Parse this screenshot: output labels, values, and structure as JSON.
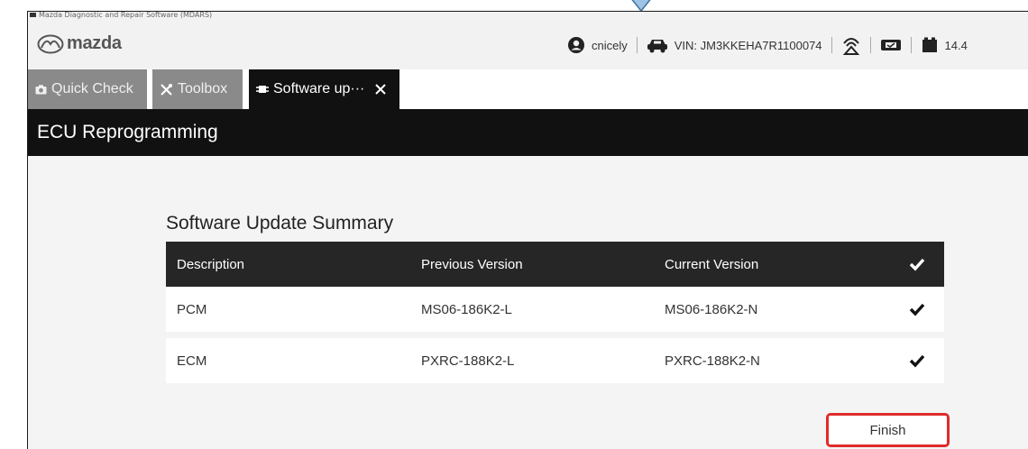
{
  "window": {
    "title": "Mazda Diagnostic and Repair Software (MDARS)"
  },
  "brand": {
    "logo_text": "mazda",
    "logo_color": "#555555"
  },
  "status_bar": {
    "user": "cnicely",
    "vin": "VIN: JM3KKEHA7R1100074",
    "voltage": "14.4"
  },
  "tabs": [
    {
      "label": "Quick Check",
      "icon": "camera-icon",
      "active": false
    },
    {
      "label": "Toolbox",
      "icon": "tools-icon",
      "active": false
    },
    {
      "label": "Software up···",
      "icon": "ecu-chip-icon",
      "active": true
    }
  ],
  "page": {
    "title": "ECU Reprogramming"
  },
  "summary": {
    "title": "Software Update Summary",
    "columns": [
      "Description",
      "Previous Version",
      "Current Version"
    ],
    "rows": [
      {
        "description": "PCM",
        "previous": "MS06-186K2-L",
        "current": "MS06-186K2-N"
      },
      {
        "description": "ECM",
        "previous": "PXRC-188K2-L",
        "current": "PXRC-188K2-N"
      }
    ]
  },
  "actions": {
    "finish_label": "Finish",
    "highlight_color": "#e02b2b"
  },
  "colors": {
    "dark_bar": "#111111",
    "tab_inactive": "#8a8a8a",
    "arrow_fill": "#9dc3e6",
    "arrow_stroke": "#41719c"
  }
}
